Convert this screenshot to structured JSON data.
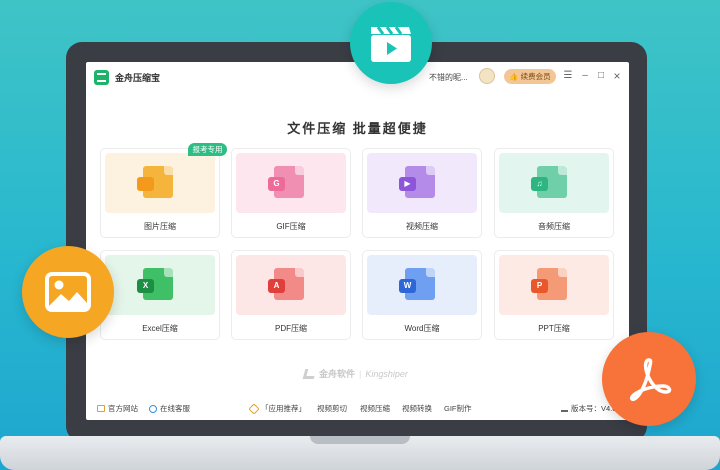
{
  "window": {
    "app_name": "金舟压缩宝",
    "user_name": "不错的昵...",
    "vip_label": "续费会员",
    "controls": {
      "menu": "☰",
      "minimize": "–",
      "maximize": "□",
      "close": "×"
    }
  },
  "headline": "文件压缩  批量超便捷",
  "cards": [
    {
      "label": "图片压缩",
      "badge": "报考专用",
      "glyph": "",
      "icon": "image-file-icon",
      "bg": "#fdf2df",
      "color": "#f5b43c",
      "tile": "#f39a1d"
    },
    {
      "label": "GIF压缩",
      "glyph": "G",
      "icon": "gif-file-icon",
      "bg": "#fde6ee",
      "color": "#f18fb2",
      "tile": "#ec6b99"
    },
    {
      "label": "视频压缩",
      "glyph": "▶",
      "icon": "video-file-icon",
      "bg": "#f1e9fb",
      "color": "#b58bea",
      "tile": "#8d56d9"
    },
    {
      "label": "音频压缩",
      "glyph": "♫",
      "icon": "audio-file-icon",
      "bg": "#e3f5ef",
      "color": "#6fcfa8",
      "tile": "#2eb680"
    },
    {
      "label": "Excel压缩",
      "glyph": "X",
      "icon": "excel-file-icon",
      "bg": "#e4f5e9",
      "color": "#3fbf66",
      "tile": "#1d8f45"
    },
    {
      "label": "PDF压缩",
      "glyph": "A",
      "icon": "pdf-file-icon",
      "bg": "#fde7e6",
      "color": "#f28a87",
      "tile": "#e0403c"
    },
    {
      "label": "Word压缩",
      "glyph": "W",
      "icon": "word-file-icon",
      "bg": "#e6eefb",
      "color": "#6f9ff0",
      "tile": "#2e66d8"
    },
    {
      "label": "PPT压缩",
      "glyph": "P",
      "icon": "ppt-file-icon",
      "bg": "#fdeae4",
      "color": "#f59a77",
      "tile": "#e8582a"
    }
  ],
  "watermark": {
    "brand_cn": "金舟软件",
    "brand_en": "Kingshiper"
  },
  "footer": {
    "website": "官方网站",
    "support": "在线客服",
    "recommend": "「应用推荐」",
    "links": [
      "视频剪切",
      "视频压缩",
      "视频转换",
      "GIF制作"
    ],
    "version": "版本号：V4.0"
  },
  "floating_icons": [
    "video-clapper-icon",
    "image-icon",
    "pdf-icon"
  ],
  "colors": {
    "brand_green": "#1db46a",
    "teal": "#19c3b7",
    "orange": "#f5a623",
    "red_orange": "#f7733a"
  }
}
